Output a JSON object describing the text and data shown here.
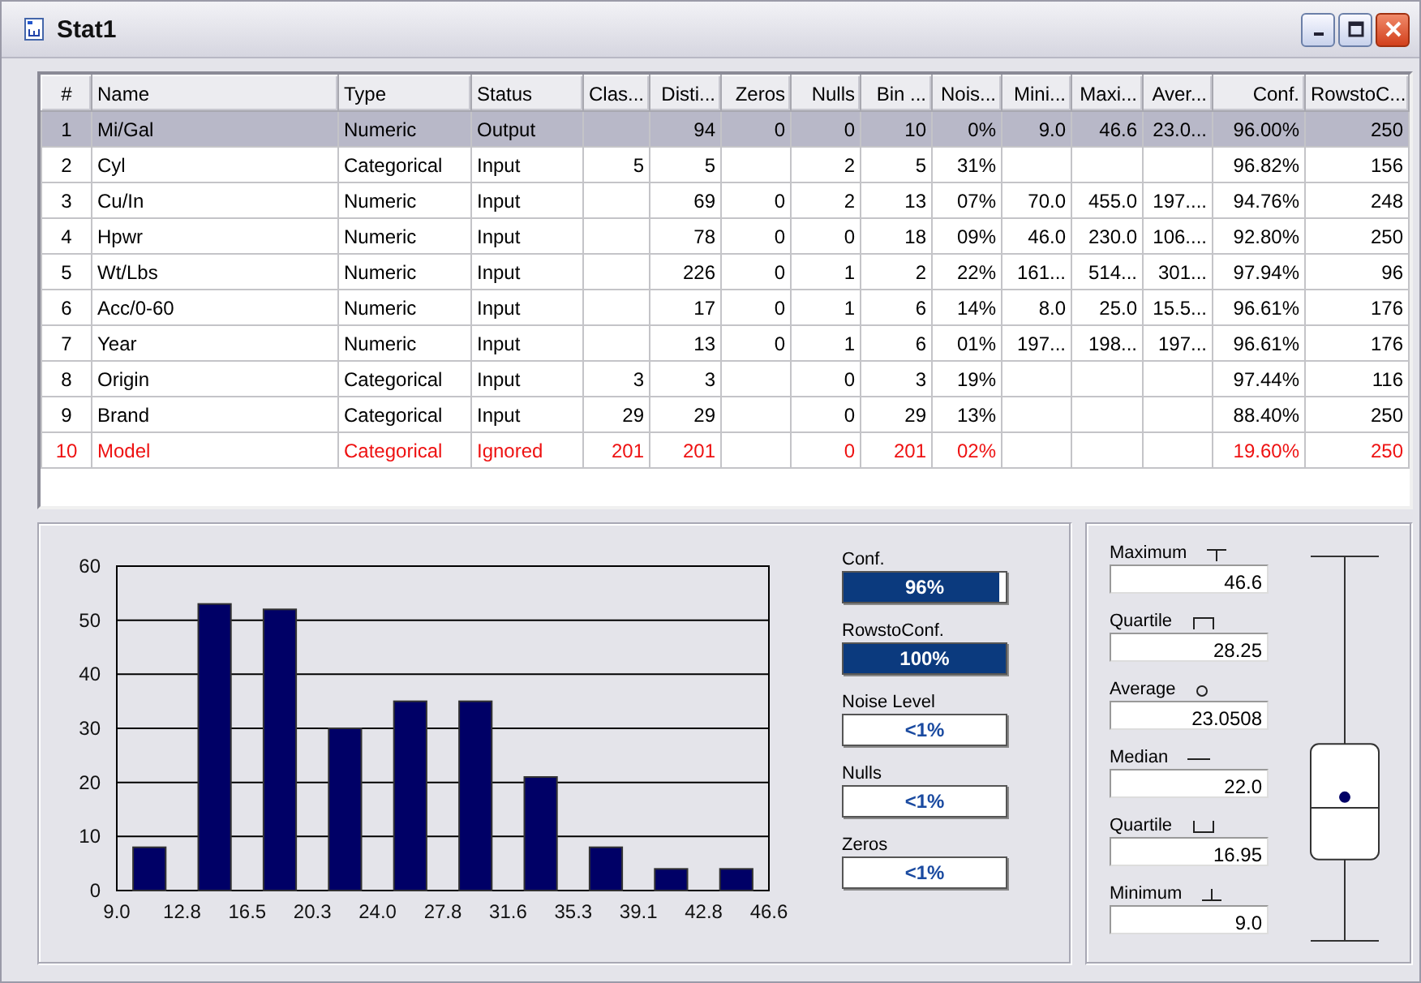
{
  "window": {
    "title": "Stat1"
  },
  "table": {
    "columns": [
      "#",
      "Name",
      "Type",
      "Status",
      "Clas...",
      "Disti...",
      "Zeros",
      "Nulls",
      "Bin ...",
      "Nois...",
      "Mini...",
      "Maxi...",
      "Aver...",
      "Conf.",
      "RowstoC..."
    ],
    "rows": [
      {
        "selected": true,
        "flagged": false,
        "cells": [
          "1",
          "Mi/Gal",
          "Numeric",
          "Output",
          null,
          "94",
          "0",
          "0",
          "10",
          "0%",
          "9.0",
          "46.6",
          "23.0...",
          "96.00%",
          "250"
        ]
      },
      {
        "selected": false,
        "flagged": false,
        "cells": [
          "2",
          "Cyl",
          "Categorical",
          "Input",
          "5",
          "5",
          null,
          "2",
          "5",
          "31%",
          null,
          null,
          null,
          "96.82%",
          "156"
        ]
      },
      {
        "selected": false,
        "flagged": false,
        "cells": [
          "3",
          "Cu/In",
          "Numeric",
          "Input",
          null,
          "69",
          "0",
          "2",
          "13",
          "07%",
          "70.0",
          "455.0",
          "197....",
          "94.76%",
          "248"
        ]
      },
      {
        "selected": false,
        "flagged": false,
        "cells": [
          "4",
          "Hpwr",
          "Numeric",
          "Input",
          null,
          "78",
          "0",
          "0",
          "18",
          "09%",
          "46.0",
          "230.0",
          "106....",
          "92.80%",
          "250"
        ]
      },
      {
        "selected": false,
        "flagged": false,
        "cells": [
          "5",
          "Wt/Lbs",
          "Numeric",
          "Input",
          null,
          "226",
          "0",
          "1",
          "2",
          "22%",
          "161...",
          "514...",
          "301...",
          "97.94%",
          "96"
        ]
      },
      {
        "selected": false,
        "flagged": false,
        "cells": [
          "6",
          "Acc/0-60",
          "Numeric",
          "Input",
          null,
          "17",
          "0",
          "1",
          "6",
          "14%",
          "8.0",
          "25.0",
          "15.5...",
          "96.61%",
          "176"
        ]
      },
      {
        "selected": false,
        "flagged": false,
        "cells": [
          "7",
          "Year",
          "Numeric",
          "Input",
          null,
          "13",
          "0",
          "1",
          "6",
          "01%",
          "197...",
          "198...",
          "197...",
          "96.61%",
          "176"
        ]
      },
      {
        "selected": false,
        "flagged": false,
        "cells": [
          "8",
          "Origin",
          "Categorical",
          "Input",
          "3",
          "3",
          null,
          "0",
          "3",
          "19%",
          null,
          null,
          null,
          "97.44%",
          "116"
        ]
      },
      {
        "selected": false,
        "flagged": false,
        "cells": [
          "9",
          "Brand",
          "Categorical",
          "Input",
          "29",
          "29",
          null,
          "0",
          "29",
          "13%",
          null,
          null,
          null,
          "88.40%",
          "250"
        ]
      },
      {
        "selected": false,
        "flagged": true,
        "cells": [
          "10",
          "Model",
          "Categorical",
          "Ignored",
          "201",
          "201",
          null,
          "0",
          "201",
          "02%",
          null,
          null,
          null,
          "19.60%",
          "250"
        ]
      }
    ]
  },
  "histogram": {
    "chart_data": {
      "type": "bar",
      "x": [
        10.88,
        14.64,
        18.4,
        22.16,
        25.92,
        29.68,
        33.44,
        37.2,
        40.96,
        44.72
      ],
      "series": [
        {
          "color": "#000066",
          "values": [
            8,
            53,
            52,
            30,
            35,
            35,
            21,
            8,
            4,
            4
          ]
        }
      ],
      "grid": true,
      "xlim": [
        9,
        46.6
      ],
      "ylim": [
        0,
        60
      ],
      "xticks": [
        {
          "value": 9,
          "label": "9.0"
        },
        {
          "value": 12.76,
          "label": "12.8"
        },
        {
          "value": 16.52,
          "label": "16.5"
        },
        {
          "value": 20.28,
          "label": "20.3"
        },
        {
          "value": 24.04,
          "label": "24.0"
        },
        {
          "value": 27.8,
          "label": "27.8"
        },
        {
          "value": 31.56,
          "label": "31.6"
        },
        {
          "value": 35.32,
          "label": "35.3"
        },
        {
          "value": 39.08,
          "label": "39.1"
        },
        {
          "value": 42.84,
          "label": "42.8"
        },
        {
          "value": 46.6,
          "label": "46.6"
        }
      ],
      "yticks": [
        0,
        10,
        20,
        30,
        40,
        50,
        60
      ]
    }
  },
  "meters": [
    {
      "label": "Conf.",
      "level": 0.96,
      "reading": "96%"
    },
    {
      "label": "RowstoConf.",
      "level": 1,
      "reading": "100%"
    },
    {
      "label": "Noise Level",
      "reading": "<1%"
    },
    {
      "label": "Nulls",
      "reading": "<1%"
    },
    {
      "label": "Zeros",
      "reading": "<1%"
    }
  ],
  "stats": [
    {
      "kind": "maximum",
      "label": "Maximum",
      "value": "46.6"
    },
    {
      "kind": "upper-quartile",
      "label": "Quartile",
      "value": "28.25"
    },
    {
      "kind": "average",
      "label": "Average",
      "value": "23.0508"
    },
    {
      "kind": "median",
      "label": "Median",
      "value": "22.0"
    },
    {
      "kind": "lower-quartile",
      "label": "Quartile",
      "value": "16.95"
    },
    {
      "kind": "minimum",
      "label": "Minimum",
      "value": "9.0"
    }
  ]
}
